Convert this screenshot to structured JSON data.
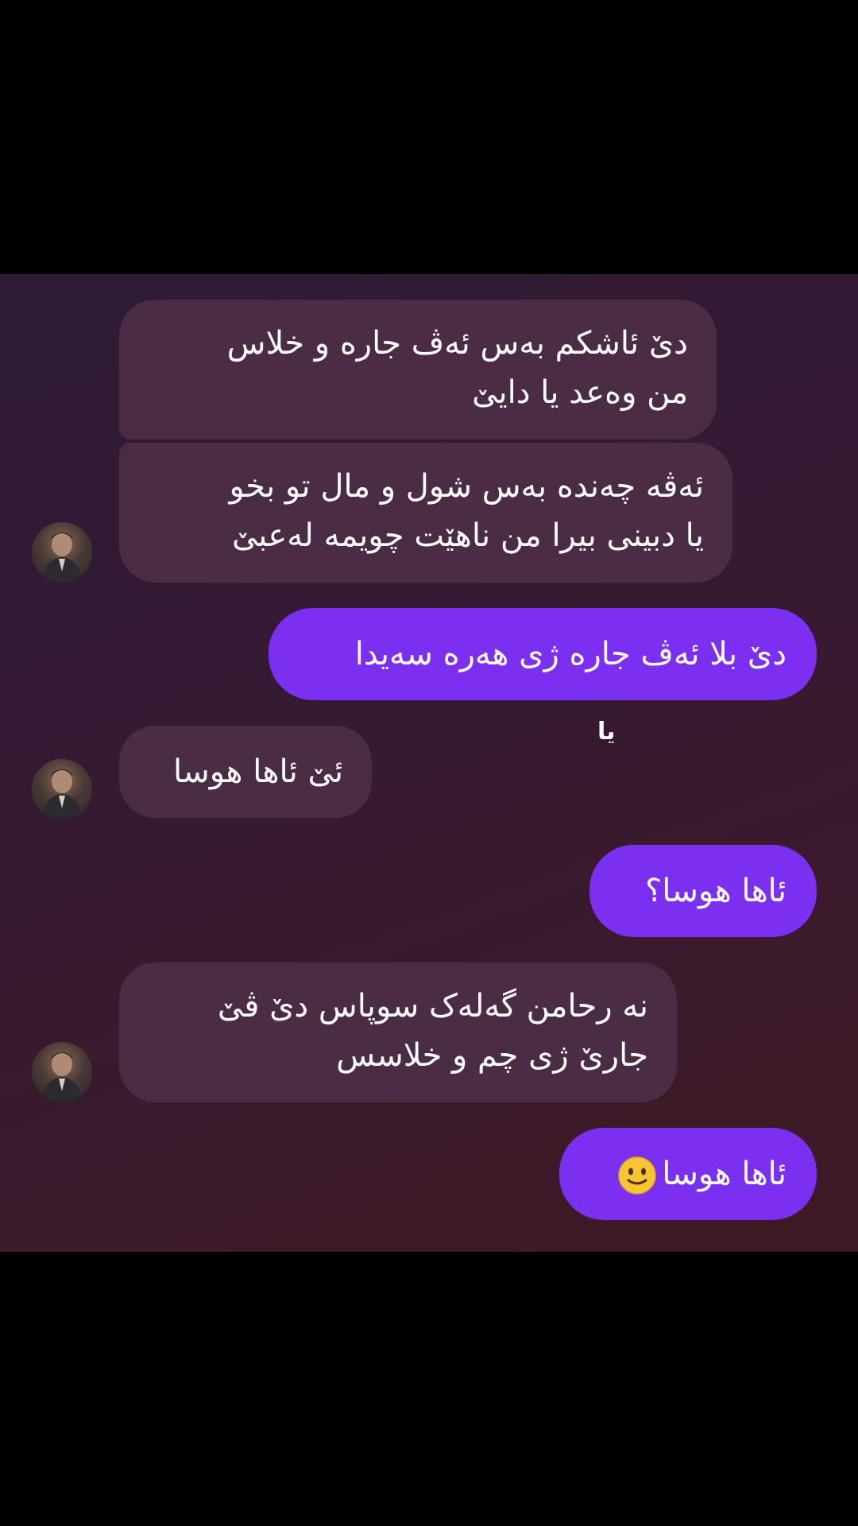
{
  "messages": {
    "m1": {
      "line1": "دێ ئاشکم بەس ئەڤ جارە و خلاس",
      "line2": "من وەعد یا دایێ"
    },
    "m2": {
      "line1": "ئەڤە چەندە بەس شول و مال تو بخو",
      "line2": "یا دبینی بیرا من ناهێت چویمە لەعبێ"
    },
    "m3": {
      "text": "دێ بلا ئەڤ جارە ژی هەرە سەیدا"
    },
    "m3_reaction": "یا",
    "m4": {
      "text": "ئێ ئاها هوسا"
    },
    "m5": {
      "text": "ئاها هوسا؟"
    },
    "m6": {
      "line1": "نە رحامن گەلەک سوپاس دێ ڤێ",
      "line2": "جارێ ژی چم و خلاسس"
    },
    "m7": {
      "text": "ئاها هوسا"
    }
  },
  "icons": {
    "avatar": "contact-avatar",
    "emoji": "slightly-smiling-face"
  },
  "colors": {
    "incoming_bubble": "#4a2d45",
    "outgoing_bubble": "#7b2ff0",
    "background": "#341a34"
  }
}
